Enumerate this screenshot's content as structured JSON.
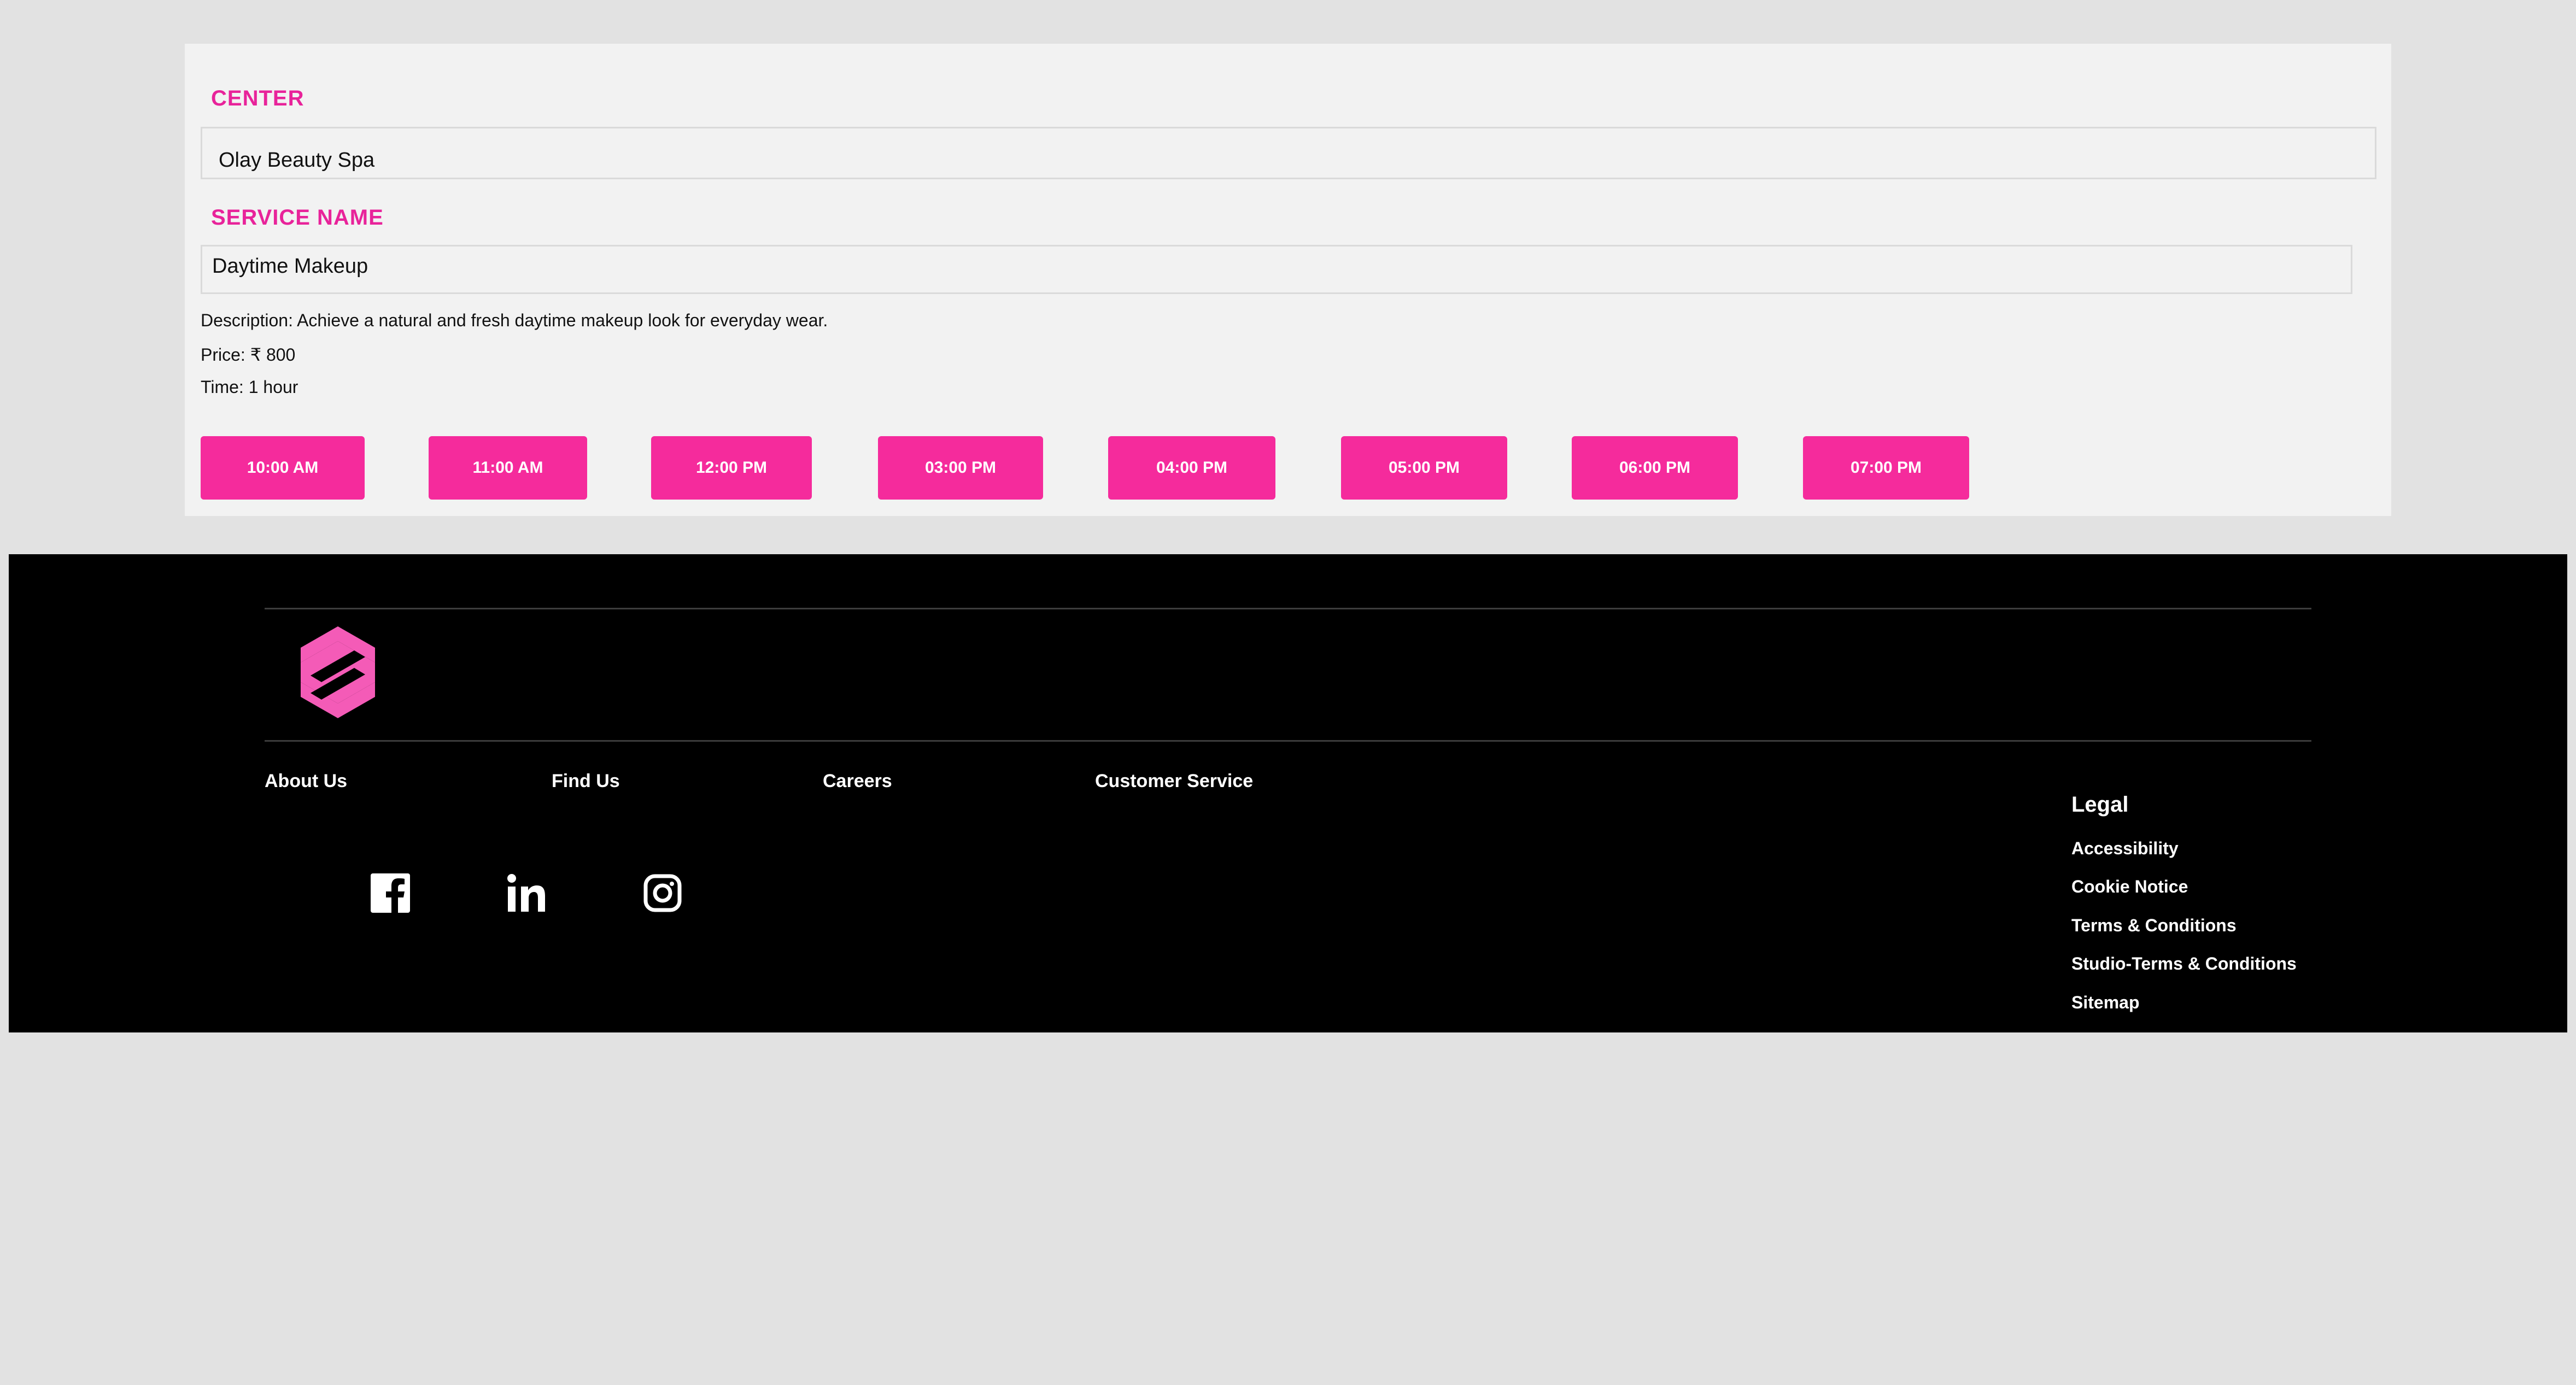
{
  "booking": {
    "center_label": "CENTER",
    "center_value": "Olay Beauty Spa",
    "service_label": "SERVICE NAME",
    "service_value": "Daytime Makeup",
    "description": "Description: Achieve a natural and fresh daytime makeup look for everyday wear.",
    "price": "Price: ₹ 800",
    "time": "Time: 1 hour",
    "slots": [
      "10:00 AM",
      "11:00 AM",
      "12:00 PM",
      "03:00 PM",
      "04:00 PM",
      "05:00 PM",
      "06:00 PM",
      "07:00 PM"
    ]
  },
  "footer": {
    "logo_icon": "hexagon-s-logo",
    "nav": [
      "About Us",
      "Find Us",
      "Careers",
      "Customer Service"
    ],
    "social_icons": [
      "facebook-icon",
      "linkedin-icon",
      "instagram-icon"
    ],
    "legal_title": "Legal",
    "legal_links": [
      "Accessibility",
      "Cookie Notice",
      "Terms & Conditions",
      "Studio-Terms & Conditions",
      "Sitemap"
    ]
  },
  "colors": {
    "accent": "#f52b9c",
    "label_accent": "#e8239a",
    "page_background": "#e2e2e2",
    "card_background": "#f2f2f2",
    "footer_background": "#000000"
  }
}
